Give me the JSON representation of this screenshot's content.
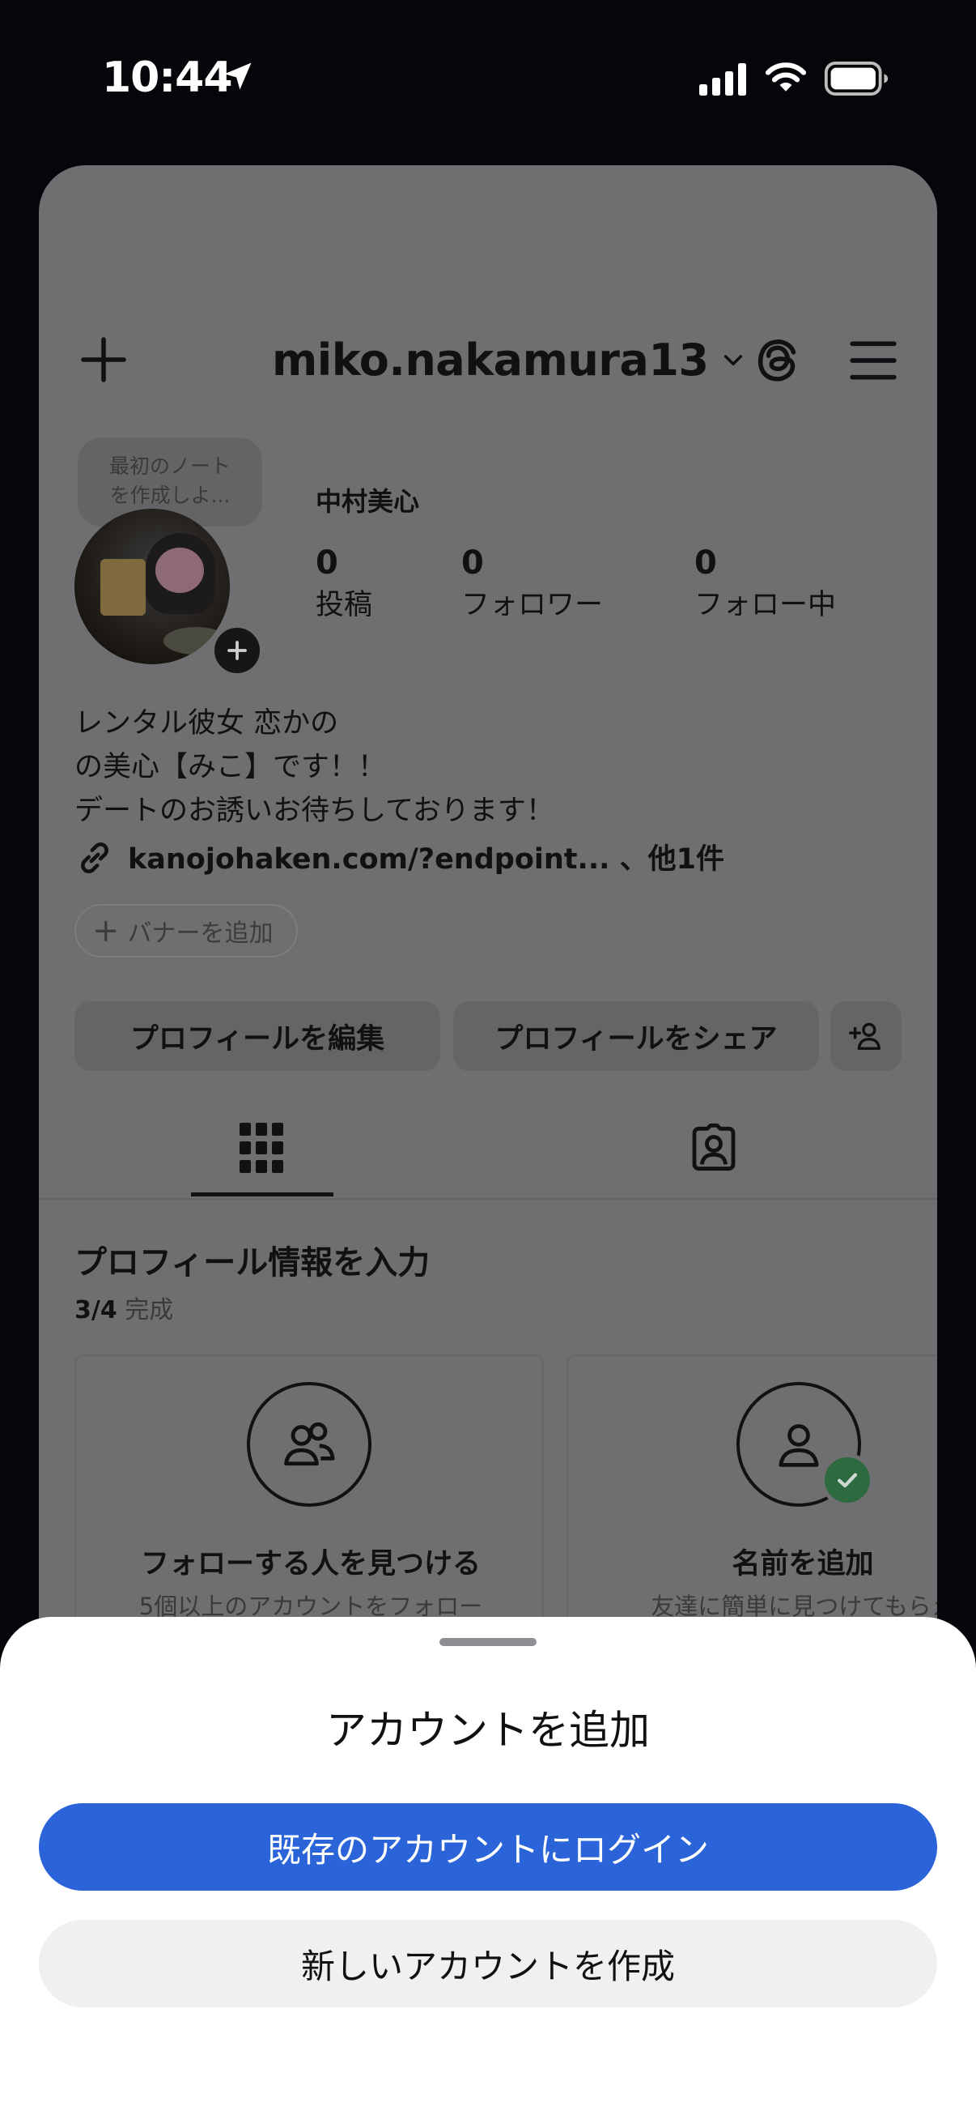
{
  "status_bar": {
    "time": "10:44",
    "icons": [
      "location-arrow-icon",
      "cellular-signal-icon",
      "wifi-icon",
      "battery-icon"
    ]
  },
  "profile": {
    "username": "miko.nakamura13",
    "note_bubble": [
      "最初のノート",
      "を作成しよ..."
    ],
    "display_name": "中村美心",
    "stats": [
      {
        "value": "0",
        "label": "投稿"
      },
      {
        "value": "0",
        "label": "フォロワー"
      },
      {
        "value": "0",
        "label": "フォロー中"
      }
    ],
    "bio": [
      "レンタル彼女 恋かの",
      "の美心【みこ】です！！",
      "デートのお誘いお待ちしております！"
    ],
    "link": "kanojohaken.com/?endpoint...  、他1件",
    "banner_chip": "バナーを追加",
    "edit_button": "プロフィールを編集",
    "share_button": "プロフィールをシェア",
    "header_icons": [
      "plus-icon",
      "chevron-down-icon",
      "threads-icon",
      "menu-icon"
    ],
    "tab_icons": [
      "grid-icon",
      "tagged-icon"
    ]
  },
  "onboarding": {
    "title": "プロフィール情報を入力",
    "progress_count": "3/4",
    "progress_label": "完成",
    "cards": [
      {
        "icon": "people-icon",
        "title": "フォローする人を見つける",
        "subtitle": "5個以上のアカウントをフォロー"
      },
      {
        "icon": "person-icon",
        "title": "名前を追加",
        "subtitle": "友達に簡単に見つけてもらえ",
        "completed": true
      }
    ]
  },
  "sheet": {
    "title": "アカウントを追加",
    "primary_button": "既存のアカウントにログイン",
    "secondary_button": "新しいアカウントを作成",
    "colors": {
      "primary": "#2b63d9",
      "secondary": "#eff0f2"
    }
  }
}
